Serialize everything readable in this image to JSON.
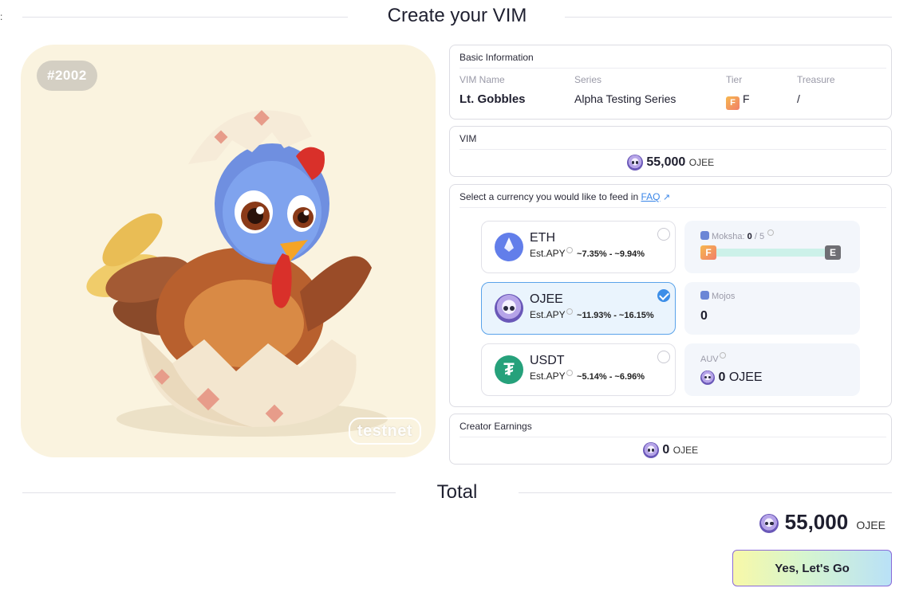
{
  "stray_mark": ":",
  "header": {
    "title": "Create your VIM"
  },
  "nft": {
    "id_badge": "#2002",
    "watermark": "testnet"
  },
  "basic_info": {
    "heading": "Basic Information",
    "vim_name_label": "VIM Name",
    "vim_name": "Lt. Gobbles",
    "series_label": "Series",
    "series": "Alpha Testing Series",
    "tier_label": "Tier",
    "tier_badge": "F",
    "tier": "F",
    "treasure_label": "Treasure",
    "treasure": "/"
  },
  "vim": {
    "heading": "VIM",
    "amount": "55,000",
    "unit": "OJEE"
  },
  "currency": {
    "prompt": "Select a currency you would like to feed in ",
    "faq_link": "FAQ",
    "faq_arrow": "↗",
    "options": [
      {
        "name": "ETH",
        "apy_label": "Est.APY",
        "apy": "~7.35% - ~9.94%",
        "selected": false
      },
      {
        "name": "OJEE",
        "apy_label": "Est.APY",
        "apy": "~11.93% - ~16.15%",
        "selected": true
      },
      {
        "name": "USDT",
        "apy_label": "Est.APY",
        "apy": "~5.14% - ~6.96%",
        "selected": false
      }
    ],
    "moksha": {
      "label": "Moksha:",
      "current": "0",
      "separator": "/",
      "max": "5",
      "start_tier": "F",
      "end_tier": "E",
      "progress": 0
    },
    "mojos": {
      "label": "Mojos",
      "value": "0"
    },
    "auv": {
      "label": "AUV",
      "amount": "0",
      "unit": "OJEE"
    }
  },
  "creator_earnings": {
    "heading": "Creator Earnings",
    "amount": "0",
    "unit": "OJEE"
  },
  "total": {
    "title": "Total",
    "amount": "55,000",
    "unit": "OJEE"
  },
  "cta": {
    "label": "Yes, Let's Go"
  },
  "colors": {
    "accent": "#3c8ee8",
    "selected_bg": "#eaf4fd",
    "card_bg": "#faf3df",
    "eth": "#627eea",
    "usdt": "#26a17b"
  }
}
